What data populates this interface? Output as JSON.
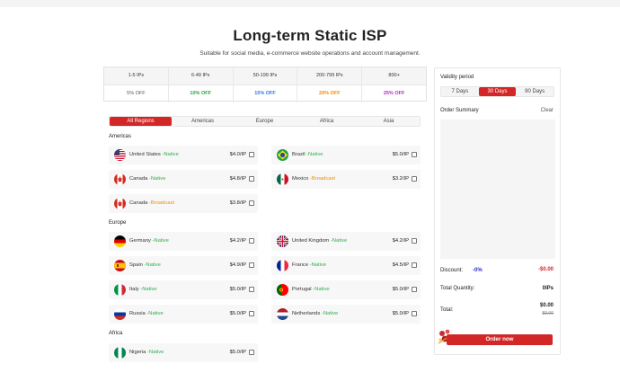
{
  "page": {
    "title": "Long-term Static ISP",
    "subtitle": "Suitable for social media, e-commerce website operations and account management."
  },
  "tiers": [
    {
      "label": "1-5 IPs",
      "discount": "5% OFF",
      "color": "#555555"
    },
    {
      "label": "6-49 IPs",
      "discount": "10% OFF",
      "color": "#22a845"
    },
    {
      "label": "50-199 IPs",
      "discount": "15% OFF",
      "color": "#2f7bd9"
    },
    {
      "label": "200-799 IPs",
      "discount": "20% OFF",
      "color": "#f08c00"
    },
    {
      "label": "800+",
      "discount": "25% OFF",
      "color": "#b429c9"
    }
  ],
  "region_tabs": [
    "All Regions",
    "Americas",
    "Europe",
    "Africa",
    "Asia"
  ],
  "sections": {
    "americas": "Americas",
    "europe": "Europe",
    "africa": "Africa"
  },
  "products": [
    {
      "name": "United States",
      "type": "-Native",
      "price": "$4.0/IP",
      "flag": "us-flag-icon"
    },
    {
      "name": "Brazil",
      "type": "-Native",
      "price": "$5.0/IP",
      "flag": "br-flag-icon"
    },
    {
      "name": "Canada",
      "type": "-Native",
      "price": "$4.8/IP",
      "flag": "ca-flag-icon"
    },
    {
      "name": "Mexico",
      "type": "-Broadcast",
      "price": "$3.2/IP",
      "flag": "mx-flag-icon"
    },
    {
      "name": "Canada",
      "type": "-Broadcast",
      "price": "$3.8/IP",
      "flag": "ca-flag-icon"
    },
    {
      "name": "Germany",
      "type": "-Native",
      "price": "$4.2/IP",
      "flag": "de-flag-icon"
    },
    {
      "name": "United Kingdom",
      "type": "-Native",
      "price": "$4.2/IP",
      "flag": "gb-flag-icon"
    },
    {
      "name": "Spain",
      "type": "-Native",
      "price": "$4.9/IP",
      "flag": "es-flag-icon"
    },
    {
      "name": "France",
      "type": "-Native",
      "price": "$4.5/IP",
      "flag": "fr-flag-icon"
    },
    {
      "name": "Italy",
      "type": "-Native",
      "price": "$5.0/IP",
      "flag": "it-flag-icon"
    },
    {
      "name": "Portugal",
      "type": "-Native",
      "price": "$5.0/IP",
      "flag": "pt-flag-icon"
    },
    {
      "name": "Russia",
      "type": "-Native",
      "price": "$5.0/IP",
      "flag": "ru-flag-icon"
    },
    {
      "name": "Netherlands",
      "type": "-Native",
      "price": "$5.0/IP",
      "flag": "nl-flag-icon"
    },
    {
      "name": "Nigeria",
      "type": "-Native",
      "price": "$5.0/IP",
      "flag": "ng-flag-icon"
    }
  ],
  "panel": {
    "validity_label": "Validity period",
    "validity_options": [
      "7 Days",
      "30 Days",
      "90 Days"
    ],
    "order_summary_label": "Order Summary",
    "clear_label": "Clear",
    "discount_label": "Discount:",
    "discount_pct": "-0%",
    "discount_value": "-$0.00",
    "quantity_label": "Total Quantity:",
    "quantity_value": "0IPs",
    "total_label": "Total:",
    "total_value": "$0.00",
    "total_original": "$0.00",
    "order_button": "Order now"
  },
  "colors": {
    "accent": "#d32626",
    "native": "#2eae4f",
    "broadcast": "#f08c00",
    "discount_pct": "#2b2bd9"
  }
}
